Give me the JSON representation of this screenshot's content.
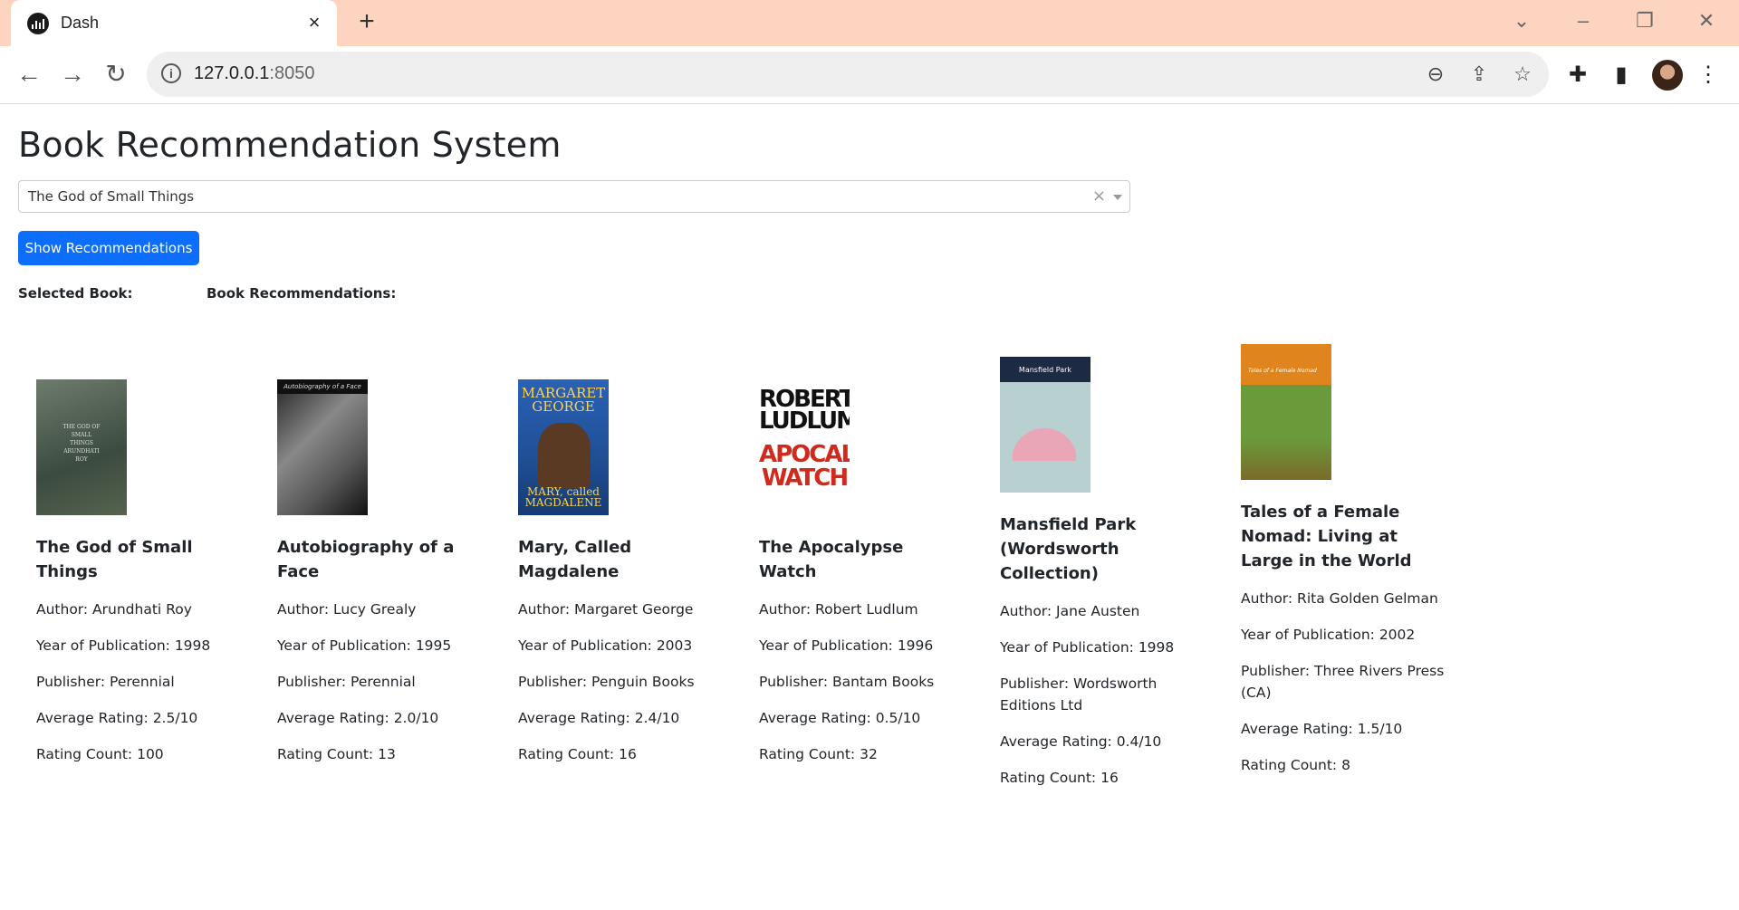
{
  "browser": {
    "tab_title": "Dash",
    "url_host": "127.0.0.1",
    "url_port": ":8050"
  },
  "page": {
    "title": "Book Recommendation System",
    "dropdown_value": "The God of Small Things",
    "button_label": "Show Recommendations",
    "selected_label": "Selected Book:",
    "recommendations_label": "Book Recommendations:"
  },
  "books": [
    {
      "title": "The God of Small Things",
      "author": "Author: Arundhati Roy",
      "year": "Year of Publication: 1998",
      "publisher": "Publisher: Perennial",
      "rating": "Average Rating: 2.5/10",
      "count": "Rating Count: 100"
    },
    {
      "title": "Autobiography of a Face",
      "author": "Author: Lucy Grealy",
      "year": "Year of Publication: 1995",
      "publisher": "Publisher: Perennial",
      "rating": "Average Rating: 2.0/10",
      "count": "Rating Count: 13"
    },
    {
      "title": "Mary, Called Magdalene",
      "author": "Author: Margaret George",
      "year": "Year of Publication: 2003",
      "publisher": "Publisher: Penguin Books",
      "rating": "Average Rating: 2.4/10",
      "count": "Rating Count: 16"
    },
    {
      "title": "The Apocalypse Watch",
      "author": "Author: Robert Ludlum",
      "year": "Year of Publication: 1996",
      "publisher": "Publisher: Bantam Books",
      "rating": "Average Rating: 0.5/10",
      "count": "Rating Count: 32"
    },
    {
      "title": "Mansfield Park (Wordsworth Collection)",
      "author": "Author: Jane Austen",
      "year": "Year of Publication: 1998",
      "publisher": "Publisher: Wordsworth Editions Ltd",
      "rating": "Average Rating: 0.4/10",
      "count": "Rating Count: 16"
    },
    {
      "title": "Tales of a Female Nomad: Living at Large in the World",
      "author": "Author: Rita Golden Gelman",
      "year": "Year of Publication: 2002",
      "publisher": "Publisher: Three Rivers Press (CA)",
      "rating": "Average Rating: 1.5/10",
      "count": "Rating Count: 8"
    }
  ],
  "covers": {
    "c1_text": "THE GOD OF SMALL THINGS ARUNDHATI ROY",
    "c2_text": "Autobiography of a Face",
    "c3_top": "MARGARET GEORGE",
    "c3_bottom": "MARY, called MAGDALENE",
    "c4_top": "ROBERT LUDLUM",
    "c4_bottom": "APOCALYPSE WATCH",
    "c5_text": "Mansfield Park",
    "c6_text": "Tales of a Female Nomad"
  }
}
